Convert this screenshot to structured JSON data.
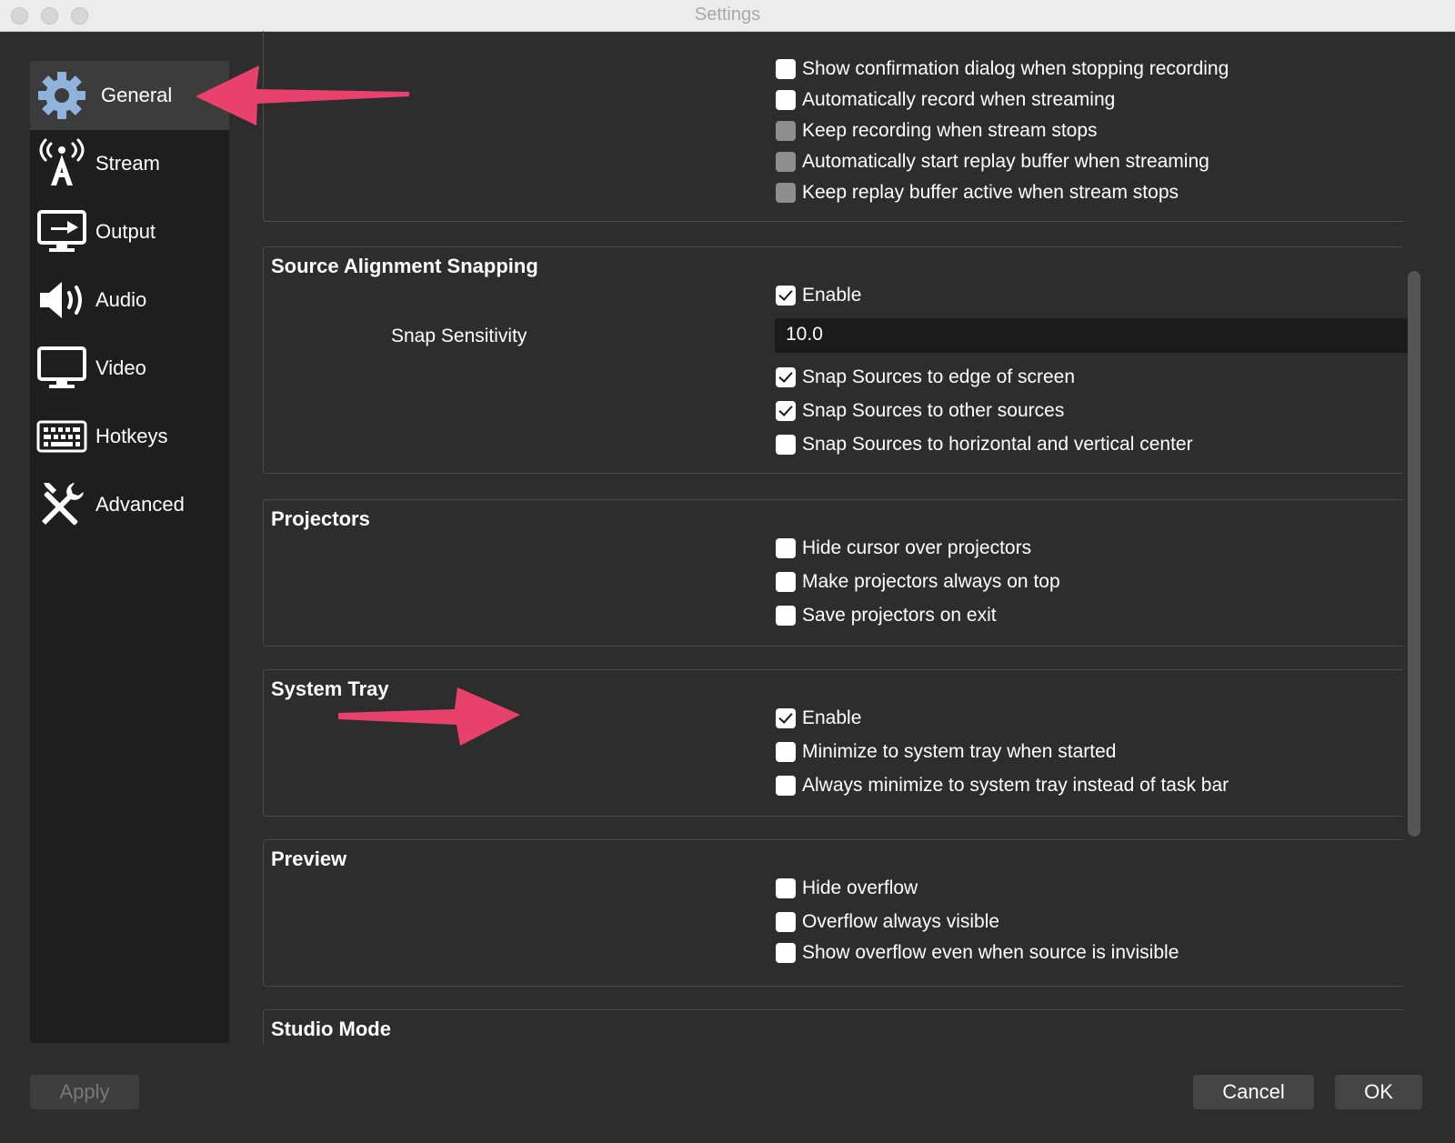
{
  "window": {
    "title": "Settings"
  },
  "sidebar": {
    "items": [
      {
        "label": "General",
        "icon": "gear-icon",
        "selected": true
      },
      {
        "label": "Stream",
        "icon": "antenna-icon"
      },
      {
        "label": "Output",
        "icon": "monitor-output-icon"
      },
      {
        "label": "Audio",
        "icon": "speaker-icon"
      },
      {
        "label": "Video",
        "icon": "monitor-icon"
      },
      {
        "label": "Hotkeys",
        "icon": "keyboard-icon"
      },
      {
        "label": "Advanced",
        "icon": "tools-icon"
      }
    ]
  },
  "output_group": {
    "options": [
      {
        "label": "Show confirmation dialog when stopping recording",
        "checked": false,
        "enabled": true
      },
      {
        "label": "Automatically record when streaming",
        "checked": false,
        "enabled": true
      },
      {
        "label": "Keep recording when stream stops",
        "checked": false,
        "enabled": false
      },
      {
        "label": "Automatically start replay buffer when streaming",
        "checked": false,
        "enabled": false
      },
      {
        "label": "Keep replay buffer active when stream stops",
        "checked": false,
        "enabled": false
      }
    ]
  },
  "snapping": {
    "title": "Source Alignment Snapping",
    "enable_label": "Enable",
    "enable_checked": true,
    "sensitivity_label": "Snap Sensitivity",
    "sensitivity_value": "10.0",
    "options": [
      {
        "label": "Snap Sources to edge of screen",
        "checked": true
      },
      {
        "label": "Snap Sources to other sources",
        "checked": true
      },
      {
        "label": "Snap Sources to horizontal and vertical center",
        "checked": false
      }
    ]
  },
  "projectors": {
    "title": "Projectors",
    "options": [
      {
        "label": "Hide cursor over projectors",
        "checked": false
      },
      {
        "label": "Make projectors always on top",
        "checked": false
      },
      {
        "label": "Save projectors on exit",
        "checked": false
      }
    ]
  },
  "system_tray": {
    "title": "System Tray",
    "options": [
      {
        "label": "Enable",
        "checked": true
      },
      {
        "label": "Minimize to system tray when started",
        "checked": false
      },
      {
        "label": "Always minimize to system tray instead of task bar",
        "checked": false
      }
    ]
  },
  "preview": {
    "title": "Preview",
    "options": [
      {
        "label": "Hide overflow",
        "checked": false
      },
      {
        "label": "Overflow always visible",
        "checked": false
      },
      {
        "label": "Show overflow even when source is invisible",
        "checked": false
      }
    ]
  },
  "studio_mode": {
    "title": "Studio Mode"
  },
  "buttons": {
    "apply": "Apply",
    "cancel": "Cancel",
    "ok": "OK"
  },
  "colors": {
    "annotation_arrow": "#e8416b",
    "window_bg": "#2d2d2d",
    "sidebar_bg": "#1e1e1e"
  }
}
